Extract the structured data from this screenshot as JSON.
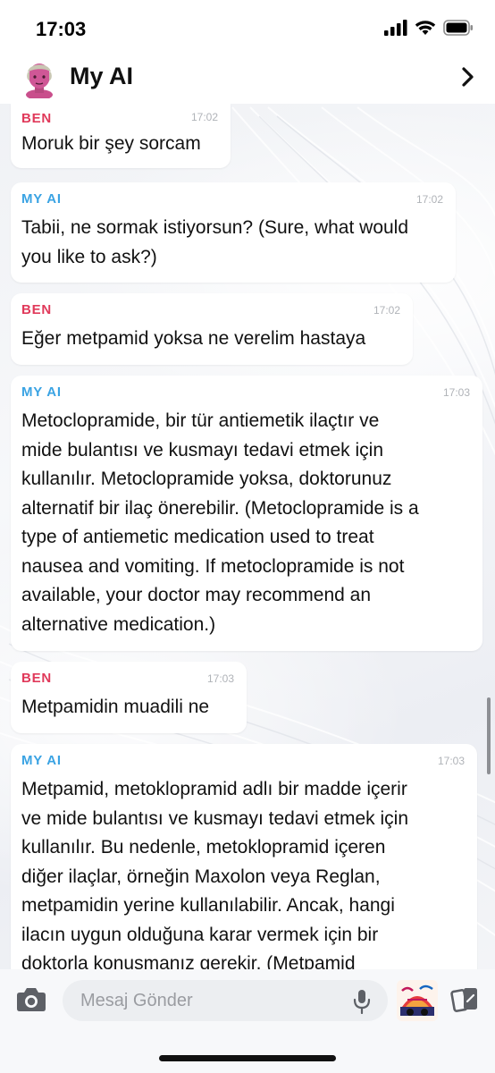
{
  "status_bar": {
    "time": "17:03"
  },
  "header": {
    "title": "My AI"
  },
  "messages": [
    {
      "sender": "BEN",
      "time": "17:02",
      "lines": [
        "Moruk bir şey sorcam"
      ]
    },
    {
      "sender": "MY AI",
      "time": "17:02",
      "lines": [
        "Tabii, ne sormak istiyorsun? (Sure, what would",
        "you like to ask?)"
      ]
    },
    {
      "sender": "BEN",
      "time": "17:02",
      "lines": [
        "Eğer metpamid yoksa ne verelim hastaya"
      ]
    },
    {
      "sender": "MY AI",
      "time": "17:03",
      "lines": [
        "Metoclopramide, bir tür antiemetik ilaçtır ve",
        "mide bulantısı ve kusmayı tedavi etmek için",
        "kullanılır. Metoclopramide yoksa, doktorunuz",
        "alternatif bir ilaç önerebilir. (Metoclopramide is a",
        "type of antiemetic medication used to treat",
        "nausea and vomiting. If metoclopramide is not",
        "available, your doctor may recommend an",
        "alternative medication.)"
      ]
    },
    {
      "sender": "BEN",
      "time": "17:03",
      "lines": [
        "Metpamidin muadili ne"
      ]
    },
    {
      "sender": "MY AI",
      "time": "17:03",
      "lines": [
        "Metpamid, metoklopramid adlı bir madde içerir",
        "ve mide bulantısı ve kusmayı tedavi etmek için",
        "kullanılır. Bu nedenle, metoklopramid içeren",
        "diğer ilaçlar, örneğin Maxolon veya Reglan,",
        "metpamidin yerine kullanılabilir. Ancak, hangi",
        "ilacın uygun olduğuna karar vermek için bir",
        "doktorla konuşmanız gerekir. (Metpamid"
      ]
    }
  ],
  "composer": {
    "placeholder": "Mesaj Gönder"
  },
  "colors": {
    "ben": "#e0395a",
    "my_ai": "#3aa3e3"
  },
  "icons": [
    "signal-icon",
    "wifi-icon",
    "battery-icon",
    "chevron-right-icon",
    "camera-icon",
    "microphone-icon",
    "bitmoji-icon",
    "cards-icon"
  ]
}
